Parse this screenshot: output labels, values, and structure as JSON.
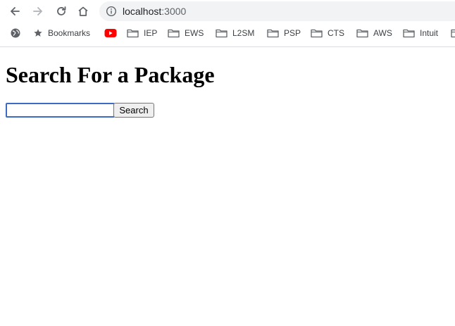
{
  "browser": {
    "url_host": "localhost",
    "url_port": ":3000",
    "icons": {
      "back": "arrow-left-icon",
      "forward": "arrow-right-icon",
      "reload": "reload-icon",
      "home": "home-icon",
      "site_info": "info-icon"
    },
    "bookmarks": [
      {
        "label": "",
        "icon": "globe-icon"
      },
      {
        "label": "Bookmarks",
        "icon": "star-icon"
      },
      {
        "label": "",
        "icon": "youtube-icon"
      },
      {
        "label": "IEP",
        "icon": "folder-icon"
      },
      {
        "label": "EWS",
        "icon": "folder-icon"
      },
      {
        "label": "L2SM",
        "icon": "folder-icon"
      },
      {
        "label": "PSP",
        "icon": "folder-icon"
      },
      {
        "label": "CTS",
        "icon": "folder-icon"
      },
      {
        "label": "AWS",
        "icon": "folder-icon"
      },
      {
        "label": "Intuit",
        "icon": "folder-icon"
      }
    ]
  },
  "page": {
    "heading": "Search For a Package",
    "search": {
      "value": "",
      "placeholder": "",
      "button_label": "Search"
    }
  },
  "colors": {
    "focus_ring": "#3b6bc4",
    "youtube_red": "#ff0000",
    "omnibox_bg": "#f1f3f4"
  }
}
